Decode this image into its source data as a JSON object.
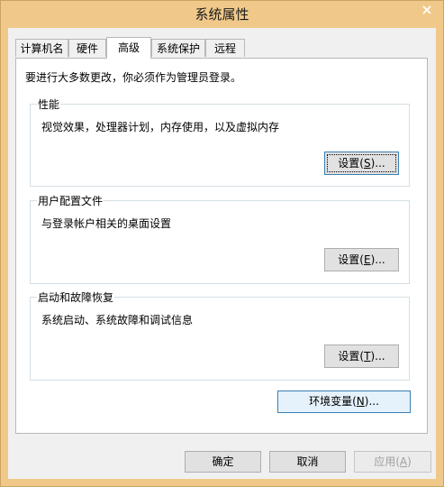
{
  "window": {
    "title": "系统属性"
  },
  "tabs": [
    {
      "label": "计算机名"
    },
    {
      "label": "硬件"
    },
    {
      "label": "高级"
    },
    {
      "label": "系统保护"
    },
    {
      "label": "远程"
    }
  ],
  "active_tab": "高级",
  "admin_note": "要进行大多数更改，你必须作为管理员登录。",
  "performance": {
    "title": "性能",
    "description": "视觉效果，处理器计划，内存使用，以及虚拟内存",
    "button": {
      "prefix": "设置(",
      "mnemonic": "S",
      "suffix": ")..."
    }
  },
  "user_profiles": {
    "title": "用户配置文件",
    "description": "与登录帐户相关的桌面设置",
    "button": {
      "prefix": "设置(",
      "mnemonic": "E",
      "suffix": ")..."
    }
  },
  "startup_recovery": {
    "title": "启动和故障恢复",
    "description": "系统启动、系统故障和调试信息",
    "button": {
      "prefix": "设置(",
      "mnemonic": "T",
      "suffix": ")..."
    }
  },
  "env_button": {
    "prefix": "环境变量(",
    "mnemonic": "N",
    "suffix": ")..."
  },
  "footer": {
    "ok": "确定",
    "cancel": "取消",
    "apply": {
      "prefix": "应用(",
      "mnemonic": "A",
      "suffix": ")"
    }
  },
  "colors": {
    "frame": "#f0c98a",
    "client": "#f0f0f0",
    "focus_border": "#3c7fb1"
  }
}
